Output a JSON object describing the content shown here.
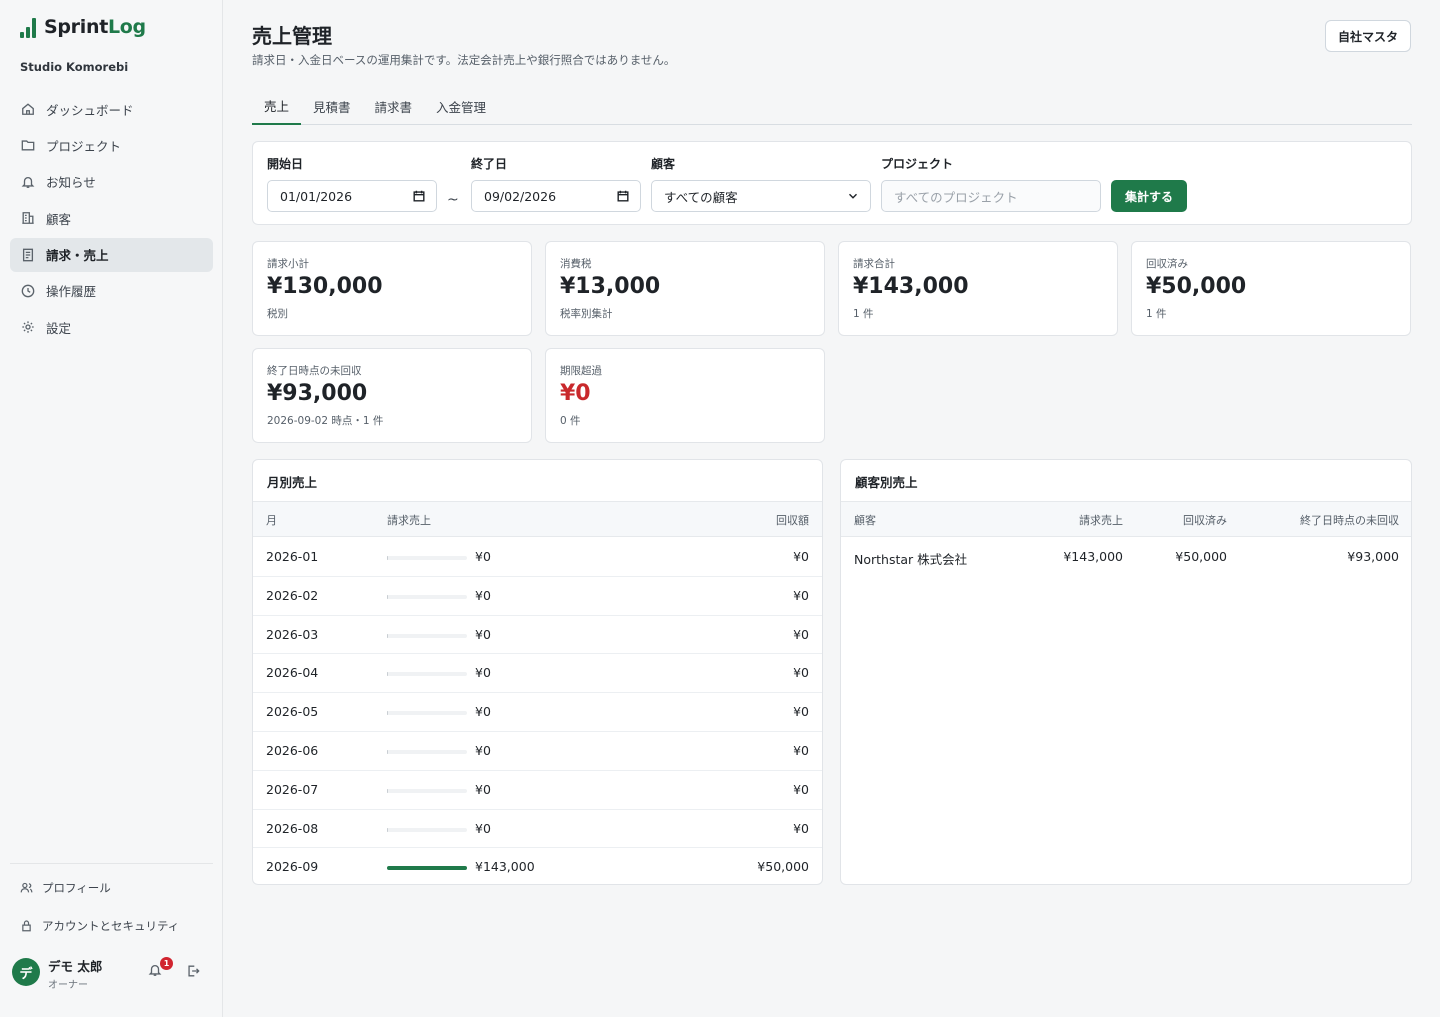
{
  "brand": {
    "name_a": "Sprint",
    "name_b": "Log",
    "org": "Studio Komorebi",
    "accent": "#1f7a4a"
  },
  "nav": [
    {
      "label": "ダッシュボード",
      "icon": "home-icon"
    },
    {
      "label": "プロジェクト",
      "icon": "folder-icon"
    },
    {
      "label": "お知らせ",
      "icon": "bell-icon"
    },
    {
      "label": "顧客",
      "icon": "building-icon"
    },
    {
      "label": "請求・売上",
      "icon": "document-icon",
      "active": true
    },
    {
      "label": "操作履歴",
      "icon": "clock-icon"
    },
    {
      "label": "設定",
      "icon": "gear-icon"
    }
  ],
  "side_bottom": {
    "profile": "プロフィール",
    "security": "アカウントとセキュリティ"
  },
  "user": {
    "initial": "デ",
    "name": "デモ 太郎",
    "role": "オーナー",
    "notifications": "1"
  },
  "header": {
    "title": "売上管理",
    "subtitle": "請求日・入金日ベースの運用集計です。法定会計売上や銀行照合ではありません。",
    "company_button": "自社マスタ"
  },
  "tabs": [
    "売上",
    "見積書",
    "請求書",
    "入金管理"
  ],
  "filter": {
    "start_label": "開始日",
    "start_value": "01/01/2026",
    "tilde": "~",
    "end_label": "終了日",
    "end_value": "09/02/2026",
    "client_label": "顧客",
    "client_value": "すべての顧客",
    "project_label": "プロジェクト",
    "project_placeholder": "すべてのプロジェクト",
    "submit": "集計する"
  },
  "stats": [
    {
      "label": "請求小計",
      "value": "¥130,000",
      "sub": "税別"
    },
    {
      "label": "消費税",
      "value": "¥13,000",
      "sub": "税率別集計"
    },
    {
      "label": "請求合計",
      "value": "¥143,000",
      "sub": "1 件"
    },
    {
      "label": "回収済み",
      "value": "¥50,000",
      "sub": "1 件"
    },
    {
      "label": "終了日時点の未回収",
      "value": "¥93,000",
      "sub": "2026-09-02 時点・1 件"
    },
    {
      "label": "期限超過",
      "value": "¥0",
      "sub": "0 件"
    }
  ],
  "monthly": {
    "title": "月別売上",
    "headers": {
      "month": "月",
      "billed": "請求売上",
      "collected": "回収額"
    },
    "rows": [
      {
        "month": "2026-01",
        "billed": "¥0",
        "collected": "¥0",
        "ratio": 0
      },
      {
        "month": "2026-02",
        "billed": "¥0",
        "collected": "¥0",
        "ratio": 0
      },
      {
        "month": "2026-03",
        "billed": "¥0",
        "collected": "¥0",
        "ratio": 0
      },
      {
        "month": "2026-04",
        "billed": "¥0",
        "collected": "¥0",
        "ratio": 0
      },
      {
        "month": "2026-05",
        "billed": "¥0",
        "collected": "¥0",
        "ratio": 0
      },
      {
        "month": "2026-06",
        "billed": "¥0",
        "collected": "¥0",
        "ratio": 0
      },
      {
        "month": "2026-07",
        "billed": "¥0",
        "collected": "¥0",
        "ratio": 0
      },
      {
        "month": "2026-08",
        "billed": "¥0",
        "collected": "¥0",
        "ratio": 0
      },
      {
        "month": "2026-09",
        "billed": "¥143,000",
        "collected": "¥50,000",
        "ratio": 1
      }
    ]
  },
  "by_client": {
    "title": "顧客別売上",
    "headers": {
      "client": "顧客",
      "billed": "請求売上",
      "collected": "回収済み",
      "outstanding": "終了日時点の未回収"
    },
    "rows": [
      {
        "client": "Northstar 株式会社",
        "billed": "¥143,000",
        "collected": "¥50,000",
        "outstanding": "¥93,000"
      }
    ]
  }
}
